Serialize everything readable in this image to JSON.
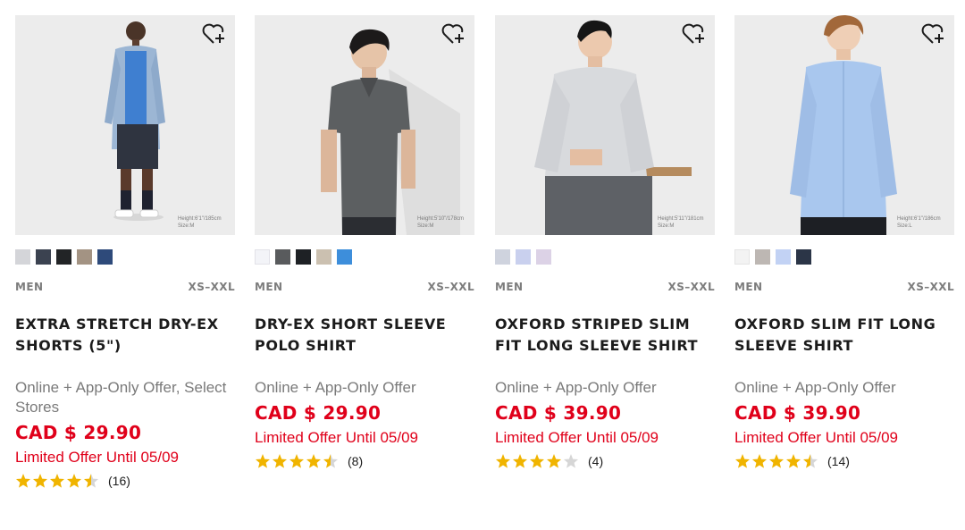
{
  "products": [
    {
      "category": "MEN",
      "sizes": "XS–XXL",
      "name": "EXTRA STRETCH DRY-EX SHORTS (5\")",
      "offer": "Online + App-Only Offer, Select Stores",
      "price": "CAD $ 29.90",
      "limited": "Limited Offer Until 05/09",
      "rating": 4.5,
      "reviews": "(16)",
      "model_info": "Height:6'1\"/185cm Size:M",
      "swatches": [
        "#d4d5d9",
        "#3b4250",
        "#222426",
        "#a39383",
        "#2e4a7a"
      ],
      "bg": "#ececec",
      "icon": "heart-plus-icon"
    },
    {
      "category": "MEN",
      "sizes": "XS–XXL",
      "name": "DRY-EX SHORT SLEEVE POLO SHIRT",
      "offer": "Online + App-Only Offer",
      "price": "CAD $ 29.90",
      "limited": "Limited Offer Until 05/09",
      "rating": 4.5,
      "reviews": "(8)",
      "model_info": "Height:5'10\"/178cm Size:M",
      "swatches": [
        "#f3f4f8",
        "#595b5d",
        "#1e2125",
        "#cbc0b0",
        "#3d8edb"
      ],
      "bg": "#ededed",
      "icon": "heart-plus-icon"
    },
    {
      "category": "MEN",
      "sizes": "XS–XXL",
      "name": "OXFORD STRIPED SLIM FIT LONG SLEEVE SHIRT",
      "offer": "Online + App-Only Offer",
      "price": "CAD $ 39.90",
      "limited": "Limited Offer Until 05/09",
      "rating": 4,
      "reviews": "(4)",
      "model_info": "Height:5'11\"/181cm Size:M",
      "swatches": [
        "#cfd3de",
        "#c9d0ee",
        "#dcd2e6"
      ],
      "bg": "#ececec",
      "icon": "heart-plus-icon"
    },
    {
      "category": "MEN",
      "sizes": "XS–XXL",
      "name": "OXFORD SLIM FIT LONG SLEEVE SHIRT",
      "offer": "Online + App-Only Offer",
      "price": "CAD $ 39.90",
      "limited": "Limited Offer Until 05/09",
      "rating": 4.5,
      "reviews": "(14)",
      "model_info": "Height:6'1\"/186cm Size:L",
      "swatches": [
        "#f3f3f3",
        "#bdb7b3",
        "#c2d2f4",
        "#2b3547"
      ],
      "bg": "#ececec",
      "icon": "heart-plus-icon"
    }
  ],
  "colors": {
    "price_red": "#e0001a",
    "star_gold": "#f0b400",
    "star_empty": "#d6d6d6"
  }
}
